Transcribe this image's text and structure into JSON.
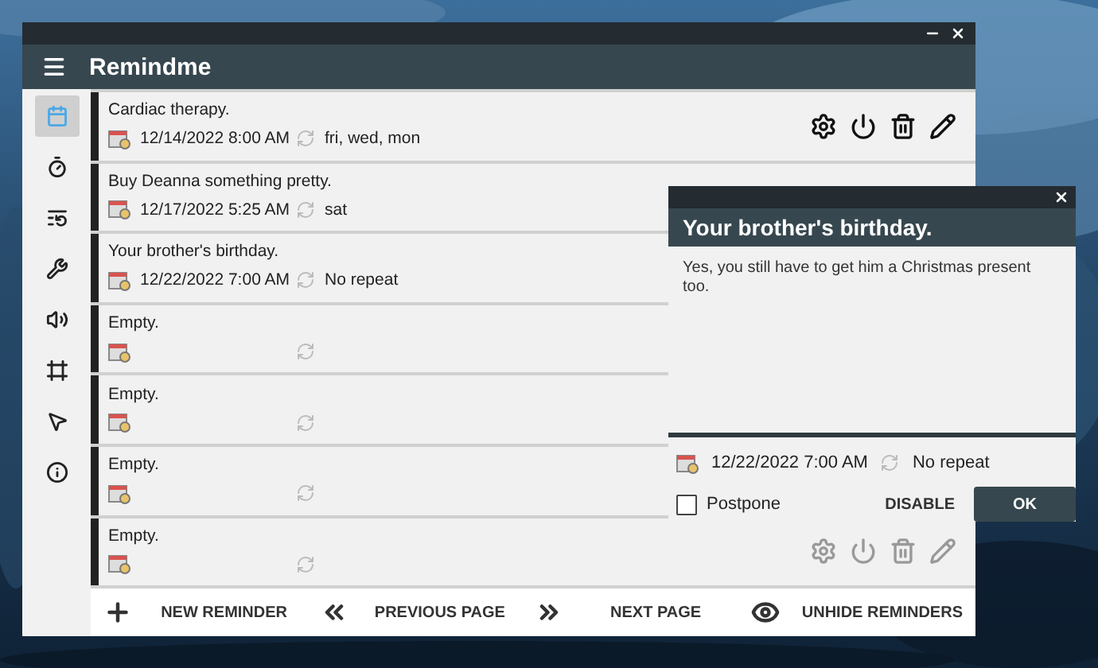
{
  "window": {
    "title": "Remindme"
  },
  "sidebar": {
    "items": [
      {
        "kind": "calendar",
        "selected": true
      },
      {
        "kind": "timer",
        "selected": false
      },
      {
        "kind": "list",
        "selected": false
      },
      {
        "kind": "wrench",
        "selected": false
      },
      {
        "kind": "sound",
        "selected": false
      },
      {
        "kind": "frame",
        "selected": false
      },
      {
        "kind": "mouse",
        "selected": false
      },
      {
        "kind": "info",
        "selected": false
      }
    ]
  },
  "reminders": [
    {
      "title": "Cardiac therapy.",
      "date": "12/14/2022 8:00 AM",
      "repeat": "fri, wed, mon",
      "actions": {
        "disabled": false
      }
    },
    {
      "title": "Buy Deanna something pretty.",
      "date": "12/17/2022 5:25 AM",
      "repeat": "sat"
    },
    {
      "title": "Your brother's birthday.",
      "date": "12/22/2022 7:00 AM",
      "repeat": "No repeat"
    },
    {
      "title": "Empty."
    },
    {
      "title": "Empty."
    },
    {
      "title": "Empty."
    },
    {
      "title": "Empty.",
      "actions": {
        "disabled": true
      }
    }
  ],
  "footer": {
    "buttons": [
      {
        "kind": "new",
        "label": "NEW REMINDER"
      },
      {
        "kind": "previous",
        "label": "PREVIOUS PAGE"
      },
      {
        "kind": "next",
        "label": "NEXT PAGE"
      },
      {
        "kind": "unhide",
        "label": "UNHIDE REMINDERS"
      }
    ]
  },
  "popup": {
    "title": "Your brother's birthday.",
    "message": "Yes, you still have to get him a Christmas present too.",
    "date": "12/22/2022 7:00 AM",
    "repeat": "No repeat",
    "postpone": {
      "label": "Postpone",
      "checked": false
    },
    "buttons": [
      {
        "kind": "flat",
        "label": "DISABLE"
      },
      {
        "kind": "primary",
        "label": "OK"
      }
    ]
  }
}
